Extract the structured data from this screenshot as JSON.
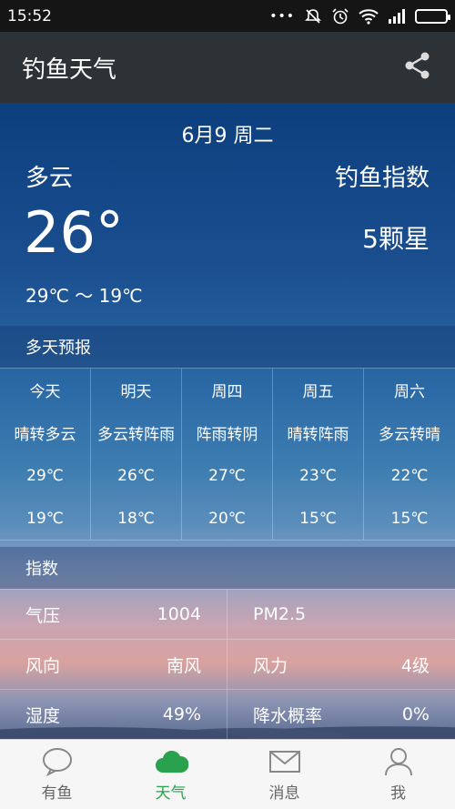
{
  "status_bar": {
    "time": "15:52"
  },
  "app": {
    "title": "钓鱼天气"
  },
  "current": {
    "date": "6月9 周二",
    "weather": "多云",
    "temperature": "26°",
    "range": "29℃ ～ 19℃",
    "fishing_index_label": "钓鱼指数",
    "fishing_index_value": "5颗星"
  },
  "forecast": {
    "title": "多天预报",
    "days": [
      {
        "day": "今天",
        "weather": "晴转多云",
        "high": "29℃",
        "low": "19℃"
      },
      {
        "day": "明天",
        "weather": "多云转阵雨",
        "high": "26℃",
        "low": "18℃"
      },
      {
        "day": "周四",
        "weather": "阵雨转阴",
        "high": "27℃",
        "low": "20℃"
      },
      {
        "day": "周五",
        "weather": "晴转阵雨",
        "high": "23℃",
        "low": "15℃"
      },
      {
        "day": "周六",
        "weather": "多云转晴",
        "high": "22℃",
        "low": "15℃"
      }
    ]
  },
  "indices": {
    "title": "指数",
    "rows": [
      {
        "left_label": "气压",
        "left_value": "1004",
        "right_label": "PM2.5",
        "right_value": ""
      },
      {
        "left_label": "风向",
        "left_value": "南风",
        "right_label": "风力",
        "right_value": "4级"
      },
      {
        "left_label": "湿度",
        "left_value": "49%",
        "right_label": "降水概率",
        "right_value": "0%"
      }
    ]
  },
  "tabs": [
    {
      "label": "有鱼",
      "icon": "chat-bubble-icon",
      "active": false
    },
    {
      "label": "天气",
      "icon": "cloud-icon",
      "active": true
    },
    {
      "label": "消息",
      "icon": "mail-icon",
      "active": false
    },
    {
      "label": "我",
      "icon": "person-icon",
      "active": false
    }
  ],
  "colors": {
    "accent": "#2aa14d",
    "appbar": "#2d3237",
    "battery": "#3bd95a"
  }
}
